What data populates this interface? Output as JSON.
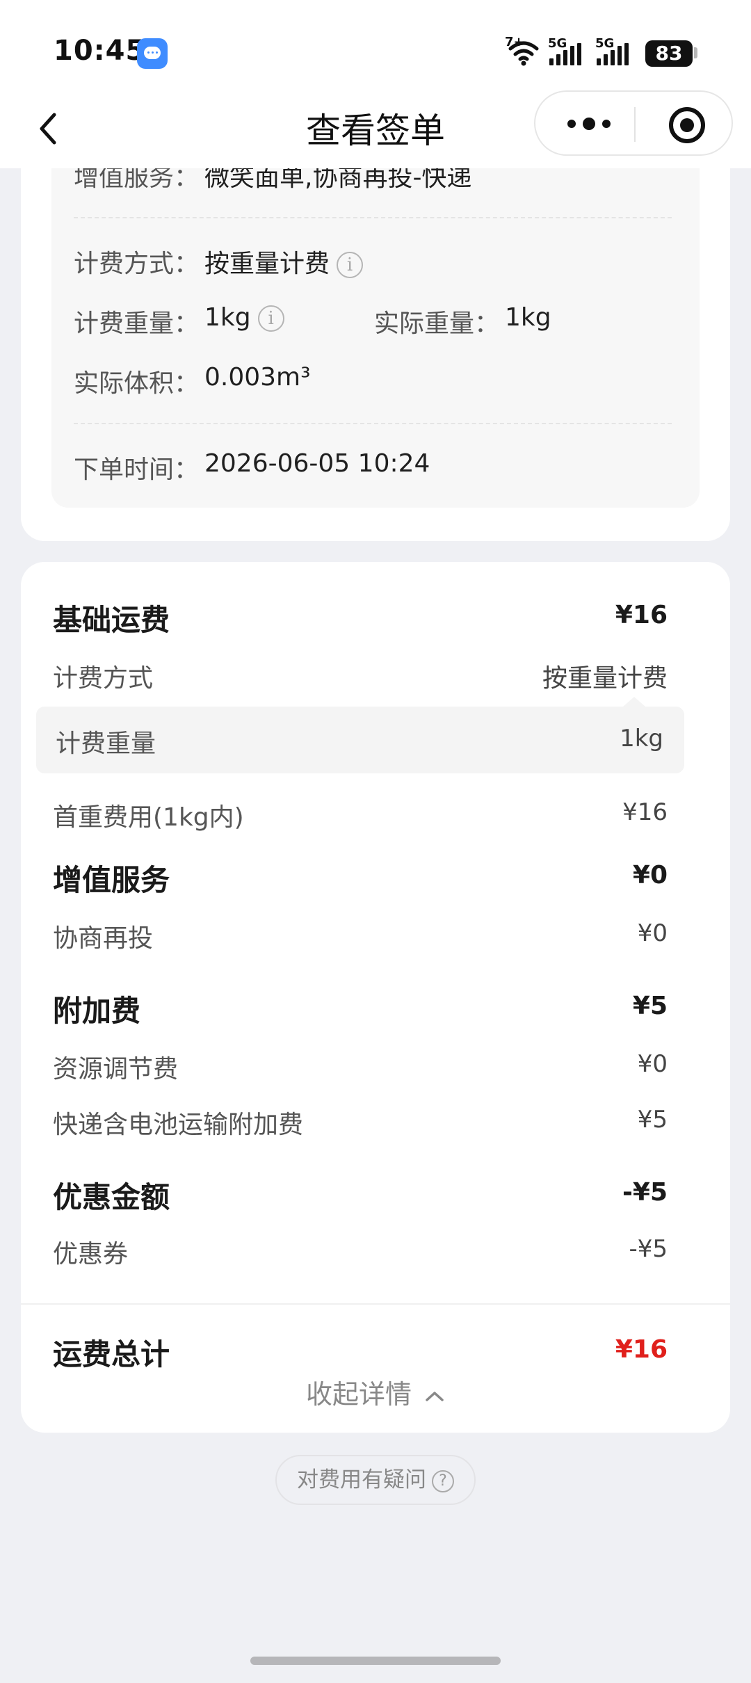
{
  "status_bar": {
    "time": "10:45",
    "network_1": "5G",
    "network_2": "5G",
    "wifi_label": "7+",
    "battery": "83",
    "icons": [
      "message-icon",
      "wifi-icon",
      "signal-icon",
      "signal-icon",
      "battery-icon"
    ]
  },
  "nav": {
    "title": "查看签单",
    "back_icon": "chevron-left-icon",
    "more_icon": "more-dots-icon",
    "close_icon": "target-close-icon"
  },
  "order_info": {
    "value_added_label": "增值服务：",
    "value_added_value": "微笑面单,协商再投-快递",
    "billing_method_label": "计费方式：",
    "billing_method_value": "按重量计费",
    "billing_weight_label": "计费重量：",
    "billing_weight_value": "1kg",
    "actual_weight_label": "实际重量：",
    "actual_weight_value": "1kg",
    "actual_volume_label": "实际体积：",
    "actual_volume_value": "0.003m³",
    "order_time_label": "下单时间：",
    "order_time_value": "2026-06-05 10:24",
    "info_glyph": "i"
  },
  "fees": {
    "base": {
      "title": "基础运费",
      "amount": "¥16",
      "method_label": "计费方式",
      "method_value": "按重量计费",
      "weight_label": "计费重量",
      "weight_value": "1kg",
      "first_weight_label": "首重费用(1kg内)",
      "first_weight_value": "¥16"
    },
    "value_added": {
      "title": "增值服务",
      "amount": "¥0",
      "items": [
        {
          "label": "协商再投",
          "value": "¥0"
        }
      ]
    },
    "surcharge": {
      "title": "附加费",
      "amount": "¥5",
      "items": [
        {
          "label": "资源调节费",
          "value": "¥0"
        },
        {
          "label": "快递含电池运输附加费",
          "value": "¥5"
        }
      ]
    },
    "discount": {
      "title": "优惠金额",
      "amount": "-¥5",
      "items": [
        {
          "label": "优惠券",
          "value": "-¥5"
        }
      ]
    },
    "total": {
      "title": "运费总计",
      "amount": "¥16"
    },
    "collapse_label": "收起详情",
    "collapse_icon": "chevron-up-icon"
  },
  "question_button": {
    "label": "对费用有疑问",
    "icon_glyph": "?"
  },
  "colors": {
    "accent_red": "#e0201c",
    "page_bg": "#eff0f4"
  }
}
